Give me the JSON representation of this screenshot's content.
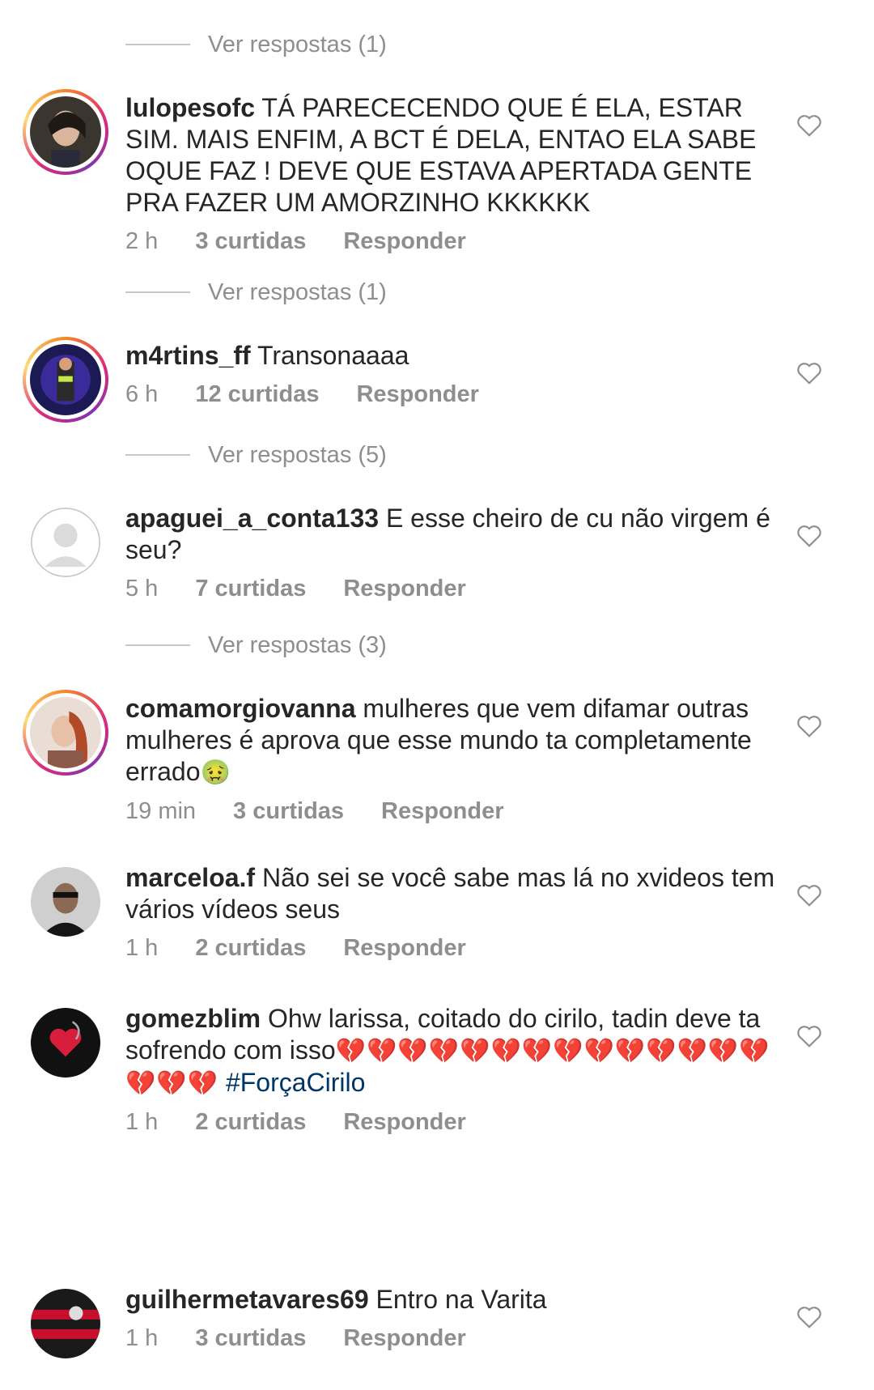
{
  "view_replies": [
    {
      "label": "Ver respostas (1)"
    },
    {
      "label": "Ver respostas (1)"
    },
    {
      "label": "Ver respostas (5)"
    },
    {
      "label": "Ver respostas (3)"
    }
  ],
  "comments": [
    {
      "username": "lulopesofc",
      "text": "TÁ PARECECENDO QUE É ELA, ESTAR SIM. MAIS ENFIM, A BCT É DELA, ENTAO ELA SABE OQUE FAZ ! DEVE QUE ESTAVA APERTADA GENTE PRA FAZER UM AMORZINHO KKKKKK",
      "time": "2 h",
      "likes": "3 curtidas",
      "reply": "Responder"
    },
    {
      "username": "m4rtins_ff",
      "text": "Transonaaaa",
      "time": "6 h",
      "likes": "12 curtidas",
      "reply": "Responder"
    },
    {
      "username": "apaguei_a_conta133",
      "text": "E esse cheiro de cu não virgem é seu?",
      "time": "5 h",
      "likes": "7 curtidas",
      "reply": "Responder"
    },
    {
      "username": "comamorgiovanna",
      "text": "mulheres que vem difamar outras mulheres é  aprova que esse mundo ta completamente errado",
      "emoji": "🤢",
      "time": "19 min",
      "likes": "3 curtidas",
      "reply": "Responder"
    },
    {
      "username": "marceloa.f",
      "text": "Não sei se você sabe mas lá no xvideos tem vários vídeos seus",
      "time": "1 h",
      "likes": "2 curtidas",
      "reply": "Responder"
    },
    {
      "username": "gomezblim",
      "text": "Ohw larissa, coitado do cirilo, tadin deve ta sofrendo com isso",
      "emoji": "💔💔💔💔💔💔💔💔💔💔💔💔💔💔💔💔💔",
      "hashtag": "#ForçaCirilo",
      "time": "1 h",
      "likes": "2 curtidas",
      "reply": "Responder"
    },
    {
      "username": "guilhermetavares69",
      "text": "Entro na Varita",
      "time": "1 h",
      "likes": "3 curtidas",
      "reply": "Responder"
    }
  ],
  "icons": {
    "heart": "heart-outline-icon",
    "avatar_placeholder": "default-avatar-icon"
  },
  "colors": {
    "text": "#262626",
    "meta": "#8e8e8e",
    "hashtag": "#003569",
    "story_ring_start": "#f58529",
    "story_ring_mid": "#dd2a7b"
  }
}
